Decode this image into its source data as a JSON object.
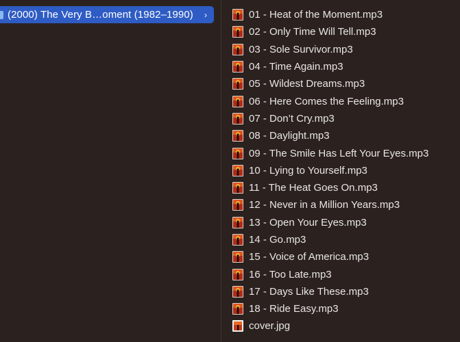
{
  "sidebar": {
    "selected_folder": {
      "label": "(2000) The Very B…oment (1982–1990)",
      "chevron": "›"
    }
  },
  "files": [
    {
      "name": "01 - Heat of the Moment.mp3",
      "icon": "album-art-icon"
    },
    {
      "name": "02 - Only Time Will Tell.mp3",
      "icon": "album-art-icon"
    },
    {
      "name": "03 - Sole Survivor.mp3",
      "icon": "album-art-icon"
    },
    {
      "name": "04 - Time Again.mp3",
      "icon": "album-art-icon"
    },
    {
      "name": "05 - Wildest Dreams.mp3",
      "icon": "album-art-icon"
    },
    {
      "name": "06 - Here Comes the Feeling.mp3",
      "icon": "album-art-icon"
    },
    {
      "name": "07 - Don’t Cry.mp3",
      "icon": "album-art-icon"
    },
    {
      "name": "08 - Daylight.mp3",
      "icon": "album-art-icon"
    },
    {
      "name": "09 - The Smile Has Left Your Eyes.mp3",
      "icon": "album-art-icon"
    },
    {
      "name": "10 - Lying to Yourself.mp3",
      "icon": "album-art-icon"
    },
    {
      "name": "11 - The Heat Goes On.mp3",
      "icon": "album-art-icon"
    },
    {
      "name": "12 - Never in a Million Years.mp3",
      "icon": "album-art-icon"
    },
    {
      "name": "13 - Open Your Eyes.mp3",
      "icon": "album-art-icon"
    },
    {
      "name": "14 - Go.mp3",
      "icon": "album-art-icon"
    },
    {
      "name": "15 - Voice of America.mp3",
      "icon": "album-art-icon"
    },
    {
      "name": "16 - Too Late.mp3",
      "icon": "album-art-icon"
    },
    {
      "name": "17 - Days Like These.mp3",
      "icon": "album-art-icon"
    },
    {
      "name": "18 - Ride Easy.mp3",
      "icon": "album-art-icon"
    },
    {
      "name": "cover.jpg",
      "icon": "image-thumbnail-icon"
    }
  ],
  "colors": {
    "background": "#2b2220",
    "selection": "#2f5cc4",
    "text": "#e9e6e4"
  }
}
